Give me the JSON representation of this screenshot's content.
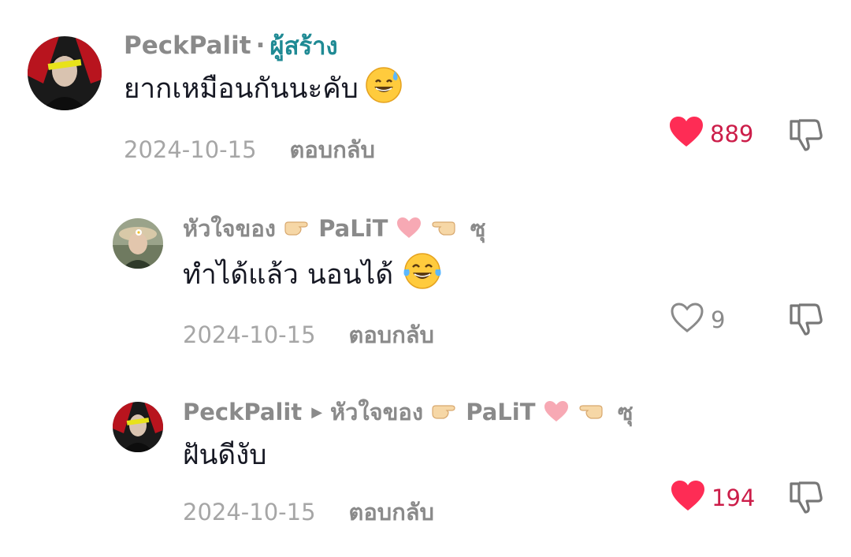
{
  "colors": {
    "text": "#161823",
    "muted": "#8a8a8a",
    "date": "#a6a6a6",
    "creator": "#1f8a94",
    "like_active": "#fe2c55",
    "like_count": "#cc1d49"
  },
  "comments": [
    {
      "username": "PeckPalit",
      "separator": "·",
      "badge": "ผู้สร้าง",
      "text": "ยากเหมือนกันนะคับ",
      "emoji_icon": "grinning-sweat-emoji",
      "date": "2024-10-15",
      "reply_label": "ตอบกลับ",
      "likes": "889",
      "liked": true
    },
    {
      "username_prefix": "หัวใจของ",
      "username_mid": "PaLiT",
      "username_suffix": "ซุ",
      "text": "ทำได้แล้ว นอนได้",
      "emoji_icon": "tears-of-joy-emoji",
      "date": "2024-10-15",
      "reply_label": "ตอบกลับ",
      "likes": "9",
      "liked": false
    },
    {
      "username": "PeckPalit",
      "reply_to_prefix": "หัวใจของ",
      "reply_to_mid": "PaLiT",
      "reply_to_suffix": "ซุ",
      "text": "ฝันดีงับ",
      "date": "2024-10-15",
      "reply_label": "ตอบกลับ",
      "likes": "194",
      "liked": true
    }
  ]
}
